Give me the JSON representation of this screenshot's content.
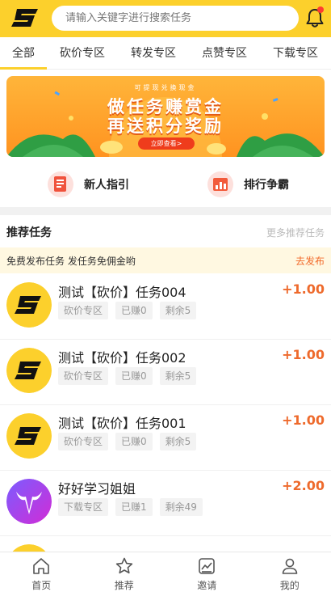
{
  "header": {
    "search_placeholder": "请输入关键字进行搜索任务"
  },
  "tabs": [
    {
      "label": "全部"
    },
    {
      "label": "砍价专区"
    },
    {
      "label": "转发专区"
    },
    {
      "label": "点赞专区"
    },
    {
      "label": "下载专区"
    }
  ],
  "banner": {
    "small_text": "可提现兑换现金",
    "title_line1": "做任务赚赏金",
    "title_line2": "再送积分奖励",
    "cta": "立即查看>"
  },
  "quick_entries": [
    {
      "label": "新人指引",
      "icon": "guide-icon"
    },
    {
      "label": "排行争霸",
      "icon": "ranking-icon"
    }
  ],
  "section": {
    "title": "推荐任务",
    "more": "更多推荐任务"
  },
  "notice": {
    "text": "免费发布任务 发任务免佣金哟",
    "link": "去发布"
  },
  "tasks": [
    {
      "title": "测试【砍价】任务004",
      "reward": "+1.00",
      "tags": [
        "砍价专区",
        "已赚0",
        "剩余5"
      ],
      "avatar": "s-logo"
    },
    {
      "title": "测试【砍价】任务002",
      "reward": "+1.00",
      "tags": [
        "砍价专区",
        "已赚0",
        "剩余5"
      ],
      "avatar": "s-logo"
    },
    {
      "title": "测试【砍价】任务001",
      "reward": "+1.00",
      "tags": [
        "砍价专区",
        "已赚0",
        "剩余5"
      ],
      "avatar": "s-logo"
    },
    {
      "title": "好好学习姐姐",
      "reward": "+2.00",
      "tags": [
        "下载专区",
        "已赚1",
        "剩余49"
      ],
      "avatar": "bull-logo"
    }
  ],
  "bottom_nav": [
    {
      "label": "首页",
      "icon": "home-icon"
    },
    {
      "label": "推荐",
      "icon": "star-icon"
    },
    {
      "label": "邀请",
      "icon": "invite-icon"
    },
    {
      "label": "我的",
      "icon": "user-icon"
    }
  ],
  "colors": {
    "brand_yellow": "#fcd02c",
    "reward_orange": "#ee6a2c",
    "notice_bg": "#fff8e1",
    "banner_orange": "#ff9320"
  }
}
